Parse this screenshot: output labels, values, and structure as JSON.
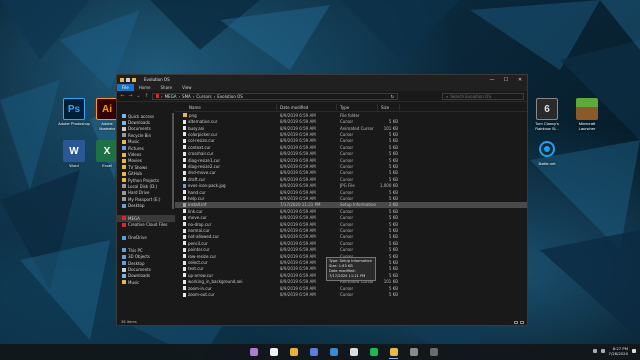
{
  "desktop": {
    "left_icons": [
      {
        "label": "Adobe Photoshop",
        "glyph": "Ps",
        "icon": "photoshop-icon"
      },
      {
        "label": "Adobe Illustrator",
        "glyph": "Ai",
        "icon": "illustrator-icon"
      },
      {
        "label": "Word",
        "glyph": "W",
        "icon": "word-icon"
      },
      {
        "label": "Excel",
        "glyph": "X",
        "icon": "excel-icon"
      }
    ],
    "right_icons": [
      {
        "label": "Tom Clancy's Rainbow Si...",
        "glyph": "6",
        "icon": "rainbow-six-icon"
      },
      {
        "label": "Minecraft Launcher",
        "glyph": "",
        "icon": "minecraft-icon"
      },
      {
        "label": "Battle.net",
        "glyph": "",
        "icon": "battlenet-icon"
      }
    ]
  },
  "window": {
    "title": "Evolution OS",
    "ribbon_tabs": [
      "File",
      "Home",
      "Share",
      "View"
    ],
    "breadcrumb": [
      "MEGA",
      "SMA",
      "Cursors",
      "Evolution OS"
    ],
    "search_placeholder": "Search Evolution OS",
    "controls": {
      "minimize": "—",
      "maximize": "☐",
      "close": "✕"
    },
    "nav_items": [
      {
        "label": "Quick access",
        "color": "#7fb8e8",
        "selected": false
      },
      {
        "label": "Downloads",
        "color": "#7fb8e8",
        "selected": false
      },
      {
        "label": "Documents",
        "color": "#cfcfcf",
        "selected": false
      },
      {
        "label": "Recycle Bin",
        "color": "#9a9a9a",
        "selected": false
      },
      {
        "label": "Music",
        "color": "#e8b84a",
        "selected": false
      },
      {
        "label": "Pictures",
        "color": "#6aa0d8",
        "selected": false
      },
      {
        "label": "Videos",
        "color": "#e8b84a",
        "selected": false
      },
      {
        "label": "Movies",
        "color": "#e8b84a",
        "selected": false
      },
      {
        "label": "TV Shows",
        "color": "#e8b84a",
        "selected": false
      },
      {
        "label": "GitHub",
        "color": "#e8b84a",
        "selected": false
      },
      {
        "label": "Python Projects",
        "color": "#e8b84a",
        "selected": false
      },
      {
        "label": "Local Disk (D:)",
        "color": "#9a9a9a",
        "selected": false
      },
      {
        "label": "Hard Drive",
        "color": "#9a9a9a",
        "selected": false
      },
      {
        "label": "My Passport (E:)",
        "color": "#9a9a9a",
        "selected": false
      },
      {
        "label": "Desktop",
        "color": "#6aa0d8",
        "selected": false
      },
      {
        "label": "",
        "color": "transparent",
        "selected": false
      },
      {
        "label": "MEGA",
        "color": "#d9272e",
        "selected": true
      },
      {
        "label": "Creative Cloud Files",
        "color": "#d9272e",
        "selected": false
      },
      {
        "label": "",
        "color": "transparent",
        "selected": false
      },
      {
        "label": "OneDrive",
        "color": "#5aa0e0",
        "selected": false
      },
      {
        "label": "",
        "color": "transparent",
        "selected": false
      },
      {
        "label": "This PC",
        "color": "#6aa0d8",
        "selected": false
      },
      {
        "label": "3D Objects",
        "color": "#6aa0d8",
        "selected": false
      },
      {
        "label": "Desktop",
        "color": "#6aa0d8",
        "selected": false
      },
      {
        "label": "Documents",
        "color": "#cfcfcf",
        "selected": false
      },
      {
        "label": "Downloads",
        "color": "#7fb8e8",
        "selected": false
      },
      {
        "label": "Music",
        "color": "#e8b84a",
        "selected": false
      }
    ],
    "columns": {
      "name": "Name",
      "date": "Date modified",
      "type": "Type",
      "size": "Size"
    },
    "files": [
      {
        "name": "png",
        "date": "8/9/2019 6:59 AM",
        "type": "File folder",
        "size": "",
        "kind": "folder"
      },
      {
        "name": "alternative.cur",
        "date": "8/9/2019 6:59 AM",
        "type": "Cursor",
        "size": "5 KB",
        "kind": "file"
      },
      {
        "name": "busy.ani",
        "date": "8/9/2019 6:59 AM",
        "type": "Animated Cursor",
        "size": "101 KB",
        "kind": "file"
      },
      {
        "name": "colorpicker.cur",
        "date": "8/9/2019 6:59 AM",
        "type": "Cursor",
        "size": "5 KB",
        "kind": "file"
      },
      {
        "name": "col-resize.cur",
        "date": "8/9/2019 6:59 AM",
        "type": "Cursor",
        "size": "5 KB",
        "kind": "file"
      },
      {
        "name": "context.cur",
        "date": "8/9/2019 6:59 AM",
        "type": "Cursor",
        "size": "5 KB",
        "kind": "file"
      },
      {
        "name": "crosshair.cur",
        "date": "8/9/2019 6:59 AM",
        "type": "Cursor",
        "size": "5 KB",
        "kind": "file"
      },
      {
        "name": "diag-resize1.cur",
        "date": "8/9/2019 6:59 AM",
        "type": "Cursor",
        "size": "5 KB",
        "kind": "file"
      },
      {
        "name": "diag-resize2.cur",
        "date": "8/9/2019 6:59 AM",
        "type": "Cursor",
        "size": "5 KB",
        "kind": "file"
      },
      {
        "name": "dnd-move.cur",
        "date": "8/9/2019 6:59 AM",
        "type": "Cursor",
        "size": "5 KB",
        "kind": "file"
      },
      {
        "name": "draft.cur",
        "date": "8/9/2019 6:59 AM",
        "type": "Cursor",
        "size": "5 KB",
        "kind": "file"
      },
      {
        "name": "evos-icon-pack.jpg",
        "date": "8/9/2019 6:59 AM",
        "type": "JPG File",
        "size": "1,000 KB",
        "kind": "img"
      },
      {
        "name": "hand.cur",
        "date": "8/9/2019 6:59 AM",
        "type": "Cursor",
        "size": "5 KB",
        "kind": "file"
      },
      {
        "name": "help.cur",
        "date": "8/9/2019 6:59 AM",
        "type": "Cursor",
        "size": "5 KB",
        "kind": "file"
      },
      {
        "name": "install.inf",
        "date": "7/17/2020 11:21 PM",
        "type": "Setup Information",
        "size": "2 KB",
        "kind": "setup",
        "selected": true
      },
      {
        "name": "link.cur",
        "date": "8/9/2019 6:59 AM",
        "type": "Cursor",
        "size": "5 KB",
        "kind": "file"
      },
      {
        "name": "move.cur",
        "date": "8/9/2019 6:59 AM",
        "type": "Cursor",
        "size": "5 KB",
        "kind": "file"
      },
      {
        "name": "no-drop.cur",
        "date": "8/9/2019 6:59 AM",
        "type": "Cursor",
        "size": "5 KB",
        "kind": "file"
      },
      {
        "name": "normal.cur",
        "date": "8/9/2019 6:59 AM",
        "type": "Cursor",
        "size": "5 KB",
        "kind": "file"
      },
      {
        "name": "not-allowed.cur",
        "date": "8/9/2019 6:59 AM",
        "type": "Cursor",
        "size": "5 KB",
        "kind": "file"
      },
      {
        "name": "pencil.cur",
        "date": "8/9/2019 6:59 AM",
        "type": "Cursor",
        "size": "5 KB",
        "kind": "file"
      },
      {
        "name": "pointer.cur",
        "date": "8/9/2019 6:59 AM",
        "type": "Cursor",
        "size": "5 KB",
        "kind": "file"
      },
      {
        "name": "row-resize.cur",
        "date": "8/9/2019 6:59 AM",
        "type": "Cursor",
        "size": "5 KB",
        "kind": "file"
      },
      {
        "name": "select.cur",
        "date": "8/9/2019 6:59 AM",
        "type": "Cursor",
        "size": "5 KB",
        "kind": "file"
      },
      {
        "name": "text.cur",
        "date": "8/9/2019 6:59 AM",
        "type": "Cursor",
        "size": "5 KB",
        "kind": "file"
      },
      {
        "name": "up-arrow.cur",
        "date": "8/9/2019 6:59 AM",
        "type": "Cursor",
        "size": "5 KB",
        "kind": "file"
      },
      {
        "name": "working_in_background.ani",
        "date": "8/9/2019 6:59 AM",
        "type": "Animated Cursor",
        "size": "101 KB",
        "kind": "file"
      },
      {
        "name": "zoom-in.cur",
        "date": "8/9/2019 6:59 AM",
        "type": "Cursor",
        "size": "5 KB",
        "kind": "file"
      },
      {
        "name": "zoom-out.cur",
        "date": "8/9/2019 6:59 AM",
        "type": "Cursor",
        "size": "5 KB",
        "kind": "file"
      }
    ],
    "tooltip": {
      "line1": "Type: Setup Information",
      "line2": "Size: 1.63 KB",
      "line3": "Date modified: 7/17/2020 11:21 PM"
    },
    "status": "36 items",
    "status_extra": "1 item selected  1.63 KB"
  },
  "taskbar": {
    "clock_time": "8:27 PM",
    "clock_date": "7/28/2020",
    "apps": [
      {
        "icon": "github-desktop-icon",
        "color": "#b07cd8",
        "active": false
      },
      {
        "icon": "itunes-icon",
        "color": "#f0f0f0",
        "active": false
      },
      {
        "icon": "chrome-icon",
        "color": "#e6b23c",
        "active": false
      },
      {
        "icon": "visual-studio-icon",
        "color": "#5a7fd8",
        "active": false
      },
      {
        "icon": "explorer-window-icon",
        "color": "#3a8ad0",
        "active": false
      },
      {
        "icon": "obs-icon",
        "color": "#dcdcdc",
        "active": false
      },
      {
        "icon": "spotify-icon",
        "color": "#1db954",
        "active": false
      },
      {
        "icon": "file-explorer-icon",
        "color": "#e8b84a",
        "active": true
      },
      {
        "icon": "terminal-icon",
        "color": "#8a8a8a",
        "active": false
      },
      {
        "icon": "photos-icon",
        "color": "#6a6a6a",
        "active": false
      }
    ]
  }
}
